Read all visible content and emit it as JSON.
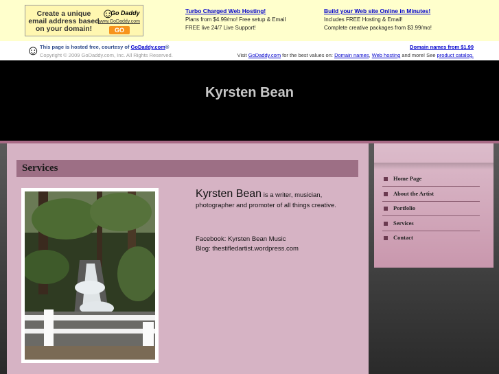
{
  "ad": {
    "box_text": "Create a unique email address based on your domain!",
    "brand": "Go Daddy",
    "brand_url": "www.GoDaddy.com",
    "go_label": "GO",
    "col1": {
      "link": "Turbo Charged Web Hosting!",
      "line1": "Plans from $4.99/mo! Free setup & Email",
      "line2": "FREE live 24/7 Live Support!"
    },
    "col2": {
      "link": "Build your Web site Online in Minutes!",
      "line1": "Includes FREE Hosting & Email!",
      "line2": "Complete creative packages from $3.99/mo!"
    }
  },
  "hosted": {
    "prefix": "This page is hosted free, courtesy of ",
    "link": "GoDaddy.com",
    "reg": "®",
    "copyright": "Copyright © 2009 GoDaddy.com, Inc. All Rights Reserved.",
    "domain_link": "Domain names from $1.99",
    "visit_prefix": "Visit ",
    "visit_link": "GoDaddy.com",
    "visit_mid": " for the best values on: ",
    "link_domains": "Domain names",
    "comma": ", ",
    "link_hosting": "Web hosting",
    "visit_mid2": " and more! See ",
    "link_catalog": "product catalog."
  },
  "site": {
    "title": "Kyrsten Bean"
  },
  "content": {
    "section_title": "Services",
    "bio_name": "Kyrsten Bean",
    "bio_text": " is a writer, musician, photographer and promoter of all things creative.",
    "facebook": "Facebook: Kyrsten Bean Music",
    "blog": "Blog: thestifledartist.wordpress.com"
  },
  "nav": {
    "items": [
      {
        "label": "Home Page"
      },
      {
        "label": "About the Artist"
      },
      {
        "label": "Portfolio"
      },
      {
        "label": "Services"
      },
      {
        "label": "Contact"
      }
    ]
  },
  "colors": {
    "accent": "#9d6f85",
    "content_bg": "#d6b3c4",
    "header_bg": "#000000"
  }
}
